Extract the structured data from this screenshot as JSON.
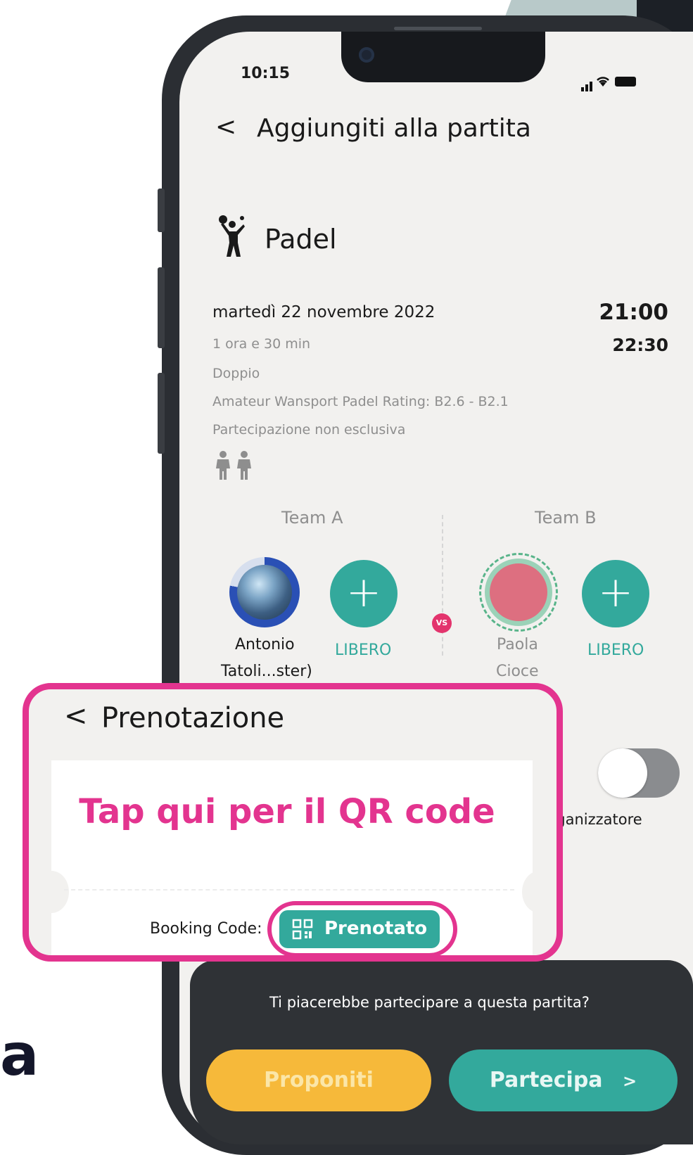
{
  "status_bar": {
    "time": "10:15"
  },
  "header": {
    "back_glyph": "<",
    "title": "Aggiungiti alla partita"
  },
  "match": {
    "sport_icon": "padel-player-icon",
    "sport": "Padel",
    "date": "martedì 22 novembre 2022",
    "start_time": "21:00",
    "end_time": "22:30",
    "duration": "1 ora e 30 min",
    "format": "Doppio",
    "rating": "Amateur Wansport Padel Rating: B2.6 - B2.1",
    "participation": "Partecipazione non esclusiva",
    "players_icon": "two-players-icon"
  },
  "teams": {
    "team_a": {
      "label": "Team A",
      "player": {
        "name_line1": "Antonio",
        "name_line2": "Tatoli...ster)"
      },
      "slot_label": "LIBERO"
    },
    "vs": "VS",
    "team_b": {
      "label": "Team B",
      "player": {
        "name_line1": "Paola",
        "name_line2": "Cioce"
      },
      "slot_label": "LIBERO"
    }
  },
  "organizer": {
    "label_partial": "rganizzatore"
  },
  "booking": {
    "back_glyph": "<",
    "title": "Prenotazione",
    "qr_tap_text": "Tap qui per il QR code",
    "code_label": "Booking Code:",
    "status": "Prenotato",
    "status_icon": "qr-code-icon"
  },
  "bottom_sheet": {
    "question": "Ti piacerebbe partecipare a questa partita?",
    "propose_label": "Proponiti",
    "join_label": "Partecipa",
    "join_glyph": ">"
  },
  "side_text": "a",
  "colors": {
    "accent_teal": "#33a99c",
    "accent_pink": "#e3348f",
    "accent_yellow": "#f6b93a",
    "sheet_dark": "#2f3236",
    "screen_bg": "#f2f1ef"
  }
}
